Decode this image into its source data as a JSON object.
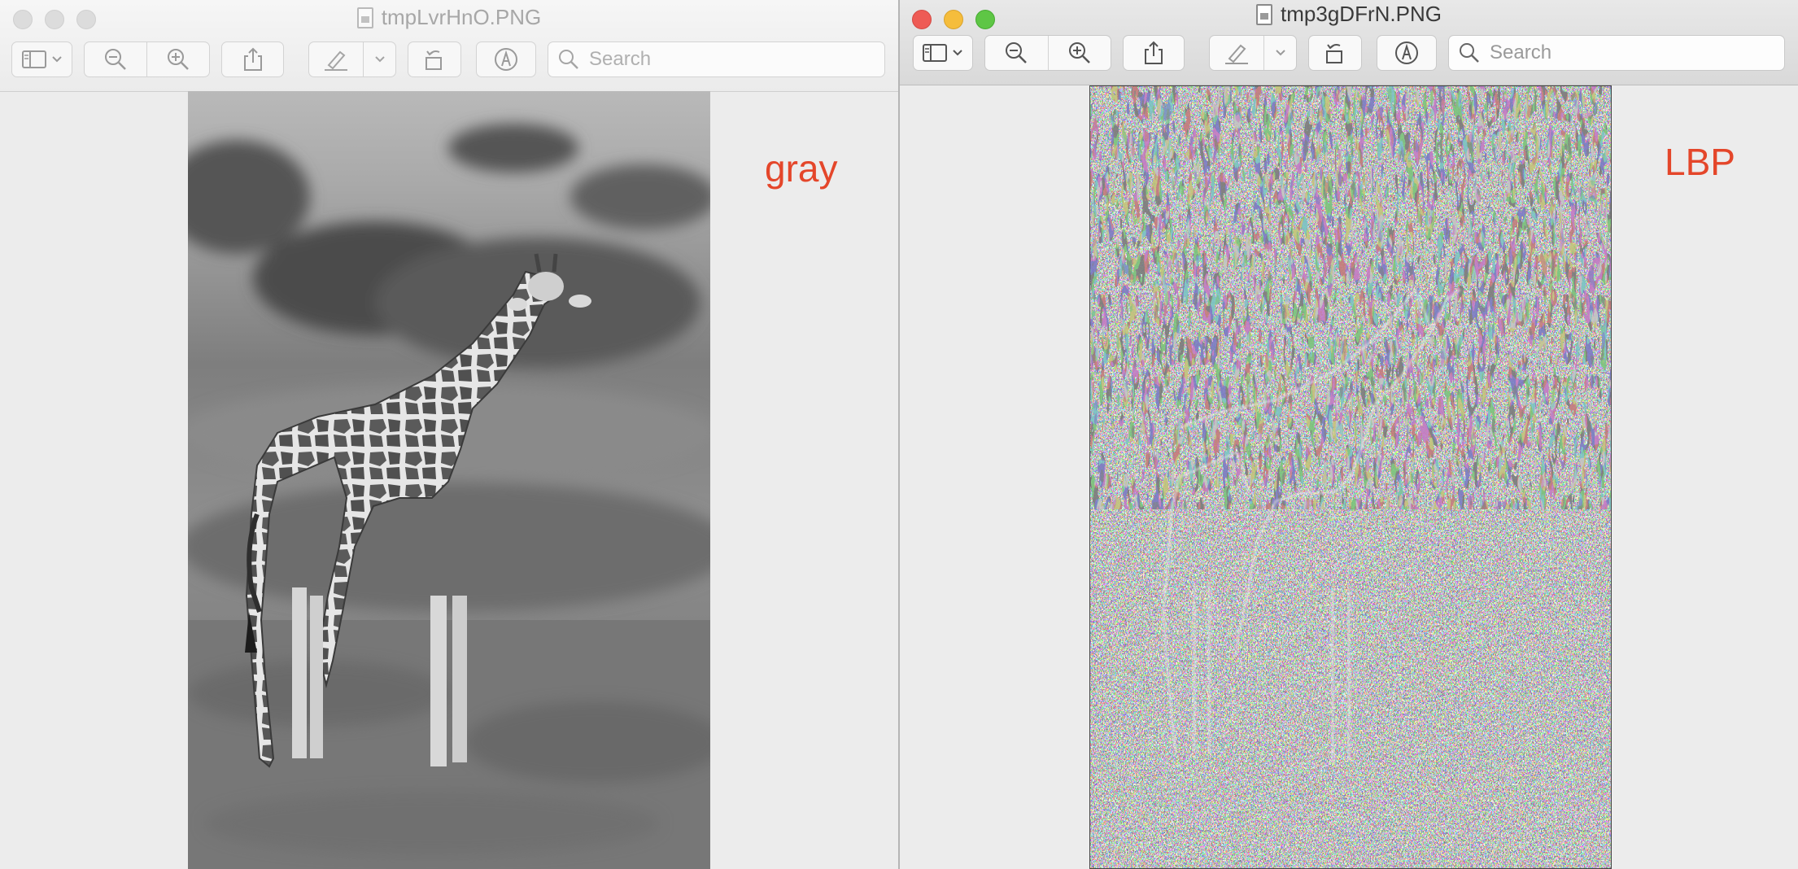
{
  "left_window": {
    "title": "tmpLvrHnO.PNG",
    "search_placeholder": "Search",
    "overlay_label": "gray",
    "image_description_icon": "document-icon"
  },
  "right_window": {
    "title": "tmp3gDFrN.PNG",
    "search_placeholder": "Search",
    "overlay_label": "LBP"
  },
  "colors": {
    "overlay_label": "#e4462a",
    "close": "#ee5b55",
    "minimize": "#f5bd3c",
    "maximize": "#5ec645"
  }
}
